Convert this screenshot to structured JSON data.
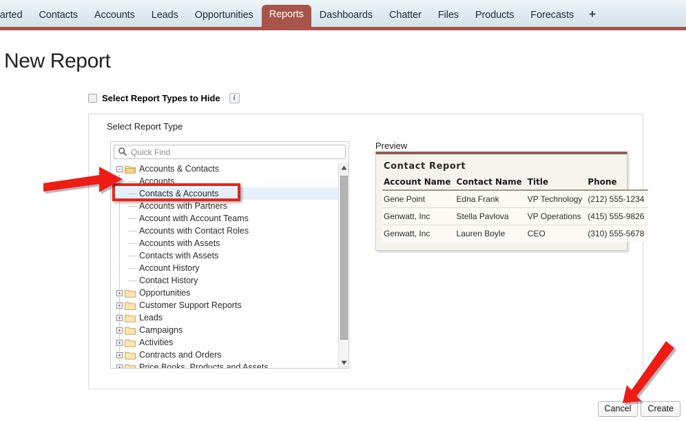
{
  "tabs": [
    {
      "label": "tarted",
      "active": false
    },
    {
      "label": "Contacts",
      "active": false
    },
    {
      "label": "Accounts",
      "active": false
    },
    {
      "label": "Leads",
      "active": false
    },
    {
      "label": "Opportunities",
      "active": false
    },
    {
      "label": "Reports",
      "active": true
    },
    {
      "label": "Dashboards",
      "active": false
    },
    {
      "label": "Chatter",
      "active": false
    },
    {
      "label": "Files",
      "active": false
    },
    {
      "label": "Products",
      "active": false
    },
    {
      "label": "Forecasts",
      "active": false
    }
  ],
  "tab_add_icon": "+",
  "page": {
    "title": "New Report"
  },
  "hide_option": {
    "label": "Select Report Types to Hide",
    "checked": false,
    "info_icon": "i"
  },
  "select_report_type": {
    "label": "Select Report Type",
    "quick_find_placeholder": "Quick Find",
    "quick_find_value": "",
    "search_icon": "search-icon"
  },
  "tree": [
    {
      "label": "Accounts & Contacts",
      "type": "folder",
      "expanded": true,
      "toggle": "−",
      "level": 0,
      "selected": false
    },
    {
      "label": "Accounts",
      "type": "item",
      "level": 1,
      "selected": false
    },
    {
      "label": "Contacts & Accounts",
      "type": "item",
      "level": 1,
      "selected": true
    },
    {
      "label": "Accounts with Partners",
      "type": "item",
      "level": 1,
      "selected": false
    },
    {
      "label": "Account with Account Teams",
      "type": "item",
      "level": 1,
      "selected": false
    },
    {
      "label": "Accounts with Contact Roles",
      "type": "item",
      "level": 1,
      "selected": false
    },
    {
      "label": "Accounts with Assets",
      "type": "item",
      "level": 1,
      "selected": false
    },
    {
      "label": "Contacts with Assets",
      "type": "item",
      "level": 1,
      "selected": false
    },
    {
      "label": "Account History",
      "type": "item",
      "level": 1,
      "selected": false
    },
    {
      "label": "Contact History",
      "type": "item",
      "level": 1,
      "selected": false
    },
    {
      "label": "Opportunities",
      "type": "folder",
      "expanded": false,
      "toggle": "+",
      "level": 0,
      "selected": false
    },
    {
      "label": "Customer Support Reports",
      "type": "folder",
      "expanded": false,
      "toggle": "+",
      "level": 0,
      "selected": false
    },
    {
      "label": "Leads",
      "type": "folder",
      "expanded": false,
      "toggle": "+",
      "level": 0,
      "selected": false
    },
    {
      "label": "Campaigns",
      "type": "folder",
      "expanded": false,
      "toggle": "+",
      "level": 0,
      "selected": false
    },
    {
      "label": "Activities",
      "type": "folder",
      "expanded": false,
      "toggle": "+",
      "level": 0,
      "selected": false
    },
    {
      "label": "Contracts and Orders",
      "type": "folder",
      "expanded": false,
      "toggle": "+",
      "level": 0,
      "selected": false
    },
    {
      "label": "Price Books, Products and Assets",
      "type": "folder",
      "expanded": false,
      "toggle": "+",
      "level": 0,
      "selected": false
    }
  ],
  "scrollbar": {
    "up_arrow": "▲",
    "down_arrow": "▼"
  },
  "preview": {
    "label": "Preview",
    "report_title": "Contact Report",
    "columns": [
      "Account Name",
      "Contact Name",
      "Title",
      "Phone"
    ],
    "rows": [
      [
        "Gene Point",
        "Edna Frank",
        "VP Technology",
        "(212) 555-1234"
      ],
      [
        "Genwatt, Inc",
        "Stella Pavlova",
        "VP Operations",
        "(415) 555-9826"
      ],
      [
        "Genwatt, Inc",
        "Lauren Boyle",
        "CEO",
        "(310) 555-5678"
      ]
    ]
  },
  "buttons": {
    "cancel": "Cancel",
    "create": "Create"
  },
  "colors": {
    "accent_brown": "#a8544a",
    "annotation_red": "#e8251b",
    "selection_blue": "#e4f0fb",
    "preview_bg": "#f5f4ec"
  }
}
